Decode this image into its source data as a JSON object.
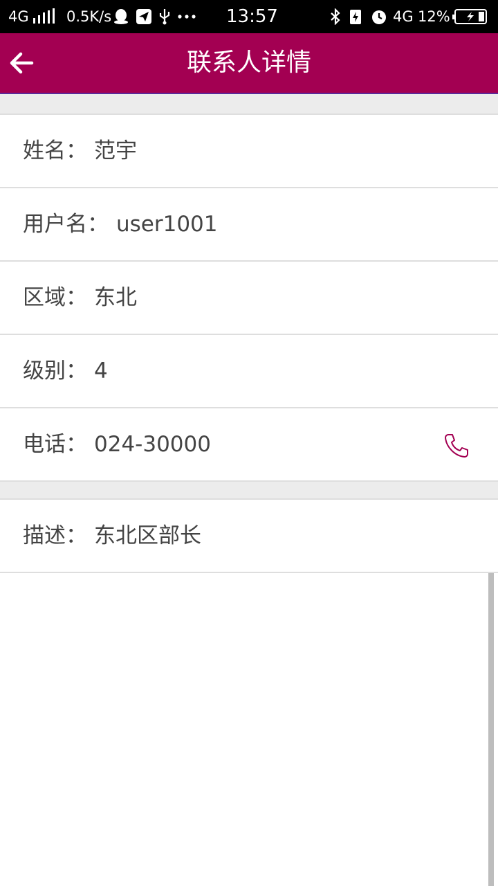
{
  "status_bar": {
    "network_left": "4G",
    "speed": "0.5K/s",
    "time": "13:57",
    "network_right": "4G",
    "battery_percent": "12%",
    "icons": [
      "signal-icon",
      "qq-icon",
      "send-icon",
      "usb-icon",
      "more-dots-icon",
      "bluetooth-icon",
      "battery-saver-icon",
      "alarm-icon",
      "battery-icon"
    ]
  },
  "header": {
    "title": "联系人详情",
    "back_icon": "arrow-left-icon",
    "background": "#a30052"
  },
  "fields": {
    "name": {
      "label": "姓名：",
      "value": "范宇"
    },
    "username": {
      "label": "用户名：",
      "value": "user1001"
    },
    "region": {
      "label": "区域：",
      "value": "东北"
    },
    "level": {
      "label": "级别：",
      "value": "4"
    },
    "phone": {
      "label": "电话：",
      "value": "024-30000",
      "action_icon": "phone-icon"
    },
    "description": {
      "label": "描述：",
      "value": "东北区部长"
    }
  },
  "colors": {
    "accent": "#a30052",
    "text": "#444444",
    "divider": "#dedede",
    "section_gap": "#ececec"
  }
}
